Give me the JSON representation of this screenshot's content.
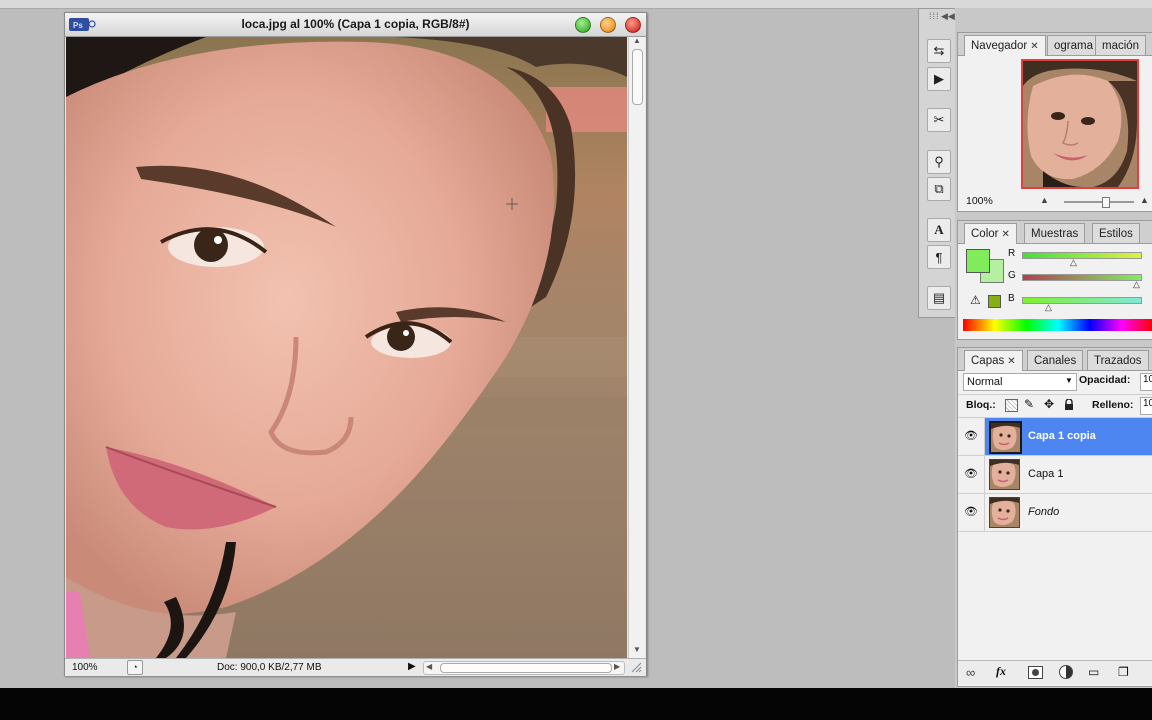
{
  "document": {
    "title": "loca.jpg al 100% (Capa 1 copia, RGB/8#)",
    "app_badge": "Ps",
    "zoom": "100%",
    "doc_info": "Doc: 900,0 KB/2,77 MB"
  },
  "navigator": {
    "tabs": [
      {
        "label": "Navegador"
      },
      {
        "label": "ograma"
      },
      {
        "label": "mación"
      }
    ],
    "zoom": "100%"
  },
  "color_panel": {
    "tabs": [
      {
        "label": "Color"
      },
      {
        "label": "Muestras"
      },
      {
        "label": "Estilos"
      }
    ],
    "sliders": [
      {
        "label": "R"
      },
      {
        "label": "G"
      },
      {
        "label": "B"
      }
    ],
    "foreground_color": "#80ec5c",
    "background_color": "#b4f0a0"
  },
  "layers_panel": {
    "tabs": [
      {
        "label": "Capas"
      },
      {
        "label": "Canales"
      },
      {
        "label": "Trazados"
      }
    ],
    "blend_mode": "Normal",
    "opacity_label": "Opacidad:",
    "opacity_value": "10",
    "lock_label": "Bloq.:",
    "fill_label": "Relleno:",
    "fill_value": "10",
    "layers": [
      {
        "name": "Capa 1 copia",
        "selected": true
      },
      {
        "name": "Capa 1",
        "selected": false
      },
      {
        "name": "Fondo",
        "selected": false
      }
    ],
    "footer_icons": [
      "link-icon",
      "fx-icon",
      "mask-icon",
      "adjustment-icon",
      "group-icon",
      "new-layer-icon"
    ]
  },
  "colors": {
    "selection_blue": "#4d86f0",
    "close_red": "#e14b3f",
    "minimize_amber": "#f2a23a",
    "zoom_green": "#57c24a"
  }
}
